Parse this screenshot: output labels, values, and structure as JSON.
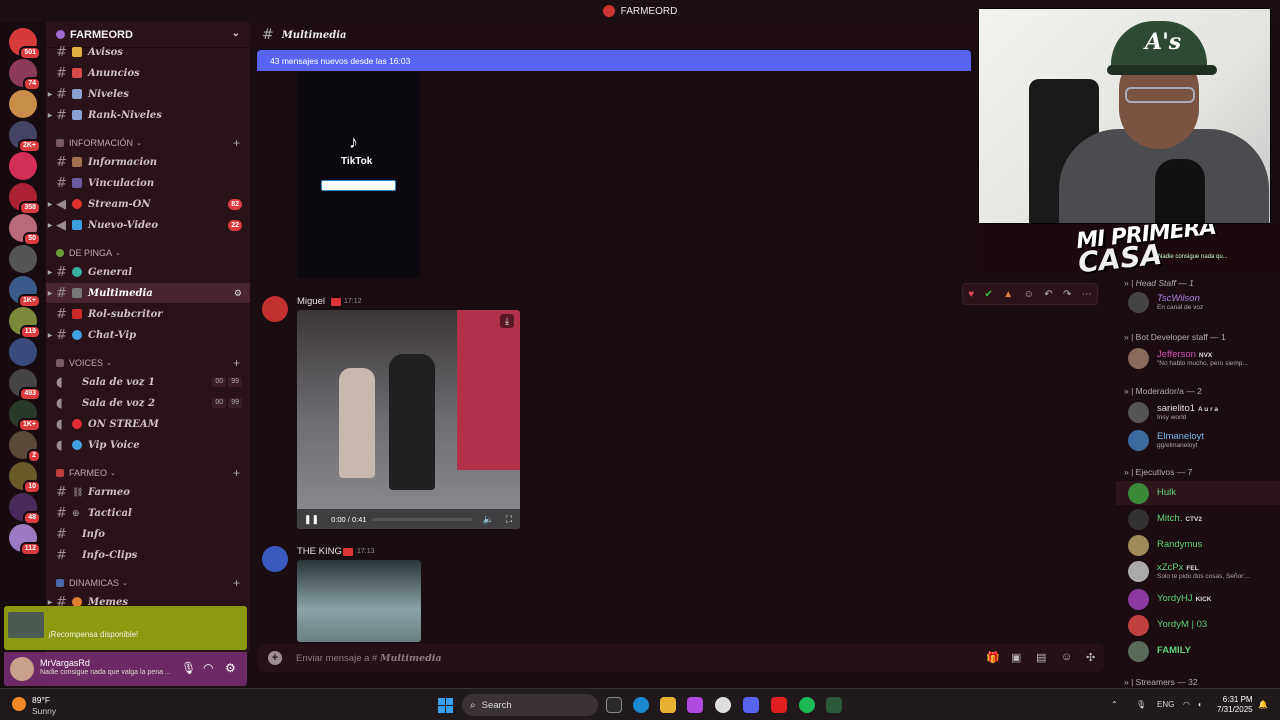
{
  "window": {
    "title": "FARMEORD"
  },
  "servers": [
    {
      "badge": "501",
      "color": "#d63a3a"
    },
    {
      "badge": "74",
      "color": "#8c3b5a"
    },
    {
      "badge": "",
      "color": "#c98f4a"
    },
    {
      "badge": "2K+",
      "color": "#446"
    },
    {
      "badge": "",
      "color": "#d22e58"
    },
    {
      "badge": "358",
      "color": "#a23"
    },
    {
      "badge": "50",
      "color": "#b86a7a"
    },
    {
      "badge": "",
      "color": "#555"
    },
    {
      "badge": "1K+",
      "color": "#3a5a8a"
    },
    {
      "badge": "119",
      "color": "#7a8a3a"
    },
    {
      "badge": "",
      "color": "#3a4a7a"
    },
    {
      "badge": "493",
      "color": "#444"
    },
    {
      "badge": "1K+",
      "color": "#2a3a2a"
    },
    {
      "badge": "2",
      "color": "#5a4a3a"
    },
    {
      "badge": "10",
      "color": "#6a5a2a"
    },
    {
      "badge": "48",
      "color": "#4a2a5a"
    },
    {
      "badge": "112",
      "color": "#9a7ac0"
    }
  ],
  "sidebar": {
    "server_name": "FARMEORD",
    "channels": [
      {
        "name": "Avisos",
        "emoji_color": "#e0b040",
        "type": "text"
      },
      {
        "name": "Anuncios",
        "emoji_color": "#d84a4a",
        "type": "text"
      },
      {
        "name": "Niveles",
        "emoji_color": "#8aa0d0",
        "type": "text"
      },
      {
        "name": "Rank-Niveles",
        "emoji_color": "#8aa0d0",
        "type": "text"
      }
    ],
    "categories": {
      "informacion": "INFORMACIÓN",
      "de_pinga": "DE PINGA",
      "voices": "VOICES",
      "farmeo": "FARMEO",
      "dinamicas": "DINAMICAS"
    },
    "info_channels": [
      {
        "name": "Informacion",
        "emoji_color": "#a07050"
      },
      {
        "name": "Vinculacion",
        "emoji_color": "#6a5aa0"
      },
      {
        "name": "Stream-ON",
        "emoji_color": "#e03030",
        "count": "82"
      },
      {
        "name": "Nuevo-Video",
        "emoji_color": "#3aa0e0",
        "count": "22"
      }
    ],
    "pinga_channels": [
      {
        "name": "General",
        "emoji_color": "#3ab0a0"
      },
      {
        "name": "Multimedia",
        "emoji_color": "#777"
      },
      {
        "name": "Rol-subcritor",
        "emoji_color": "#d02a2a"
      },
      {
        "name": "Chat-Vip",
        "emoji_color": "#40a0e0"
      }
    ],
    "voice_channels": [
      {
        "name": "Sala de voz 1",
        "a": "00",
        "b": "99"
      },
      {
        "name": "Sala de voz 2",
        "a": "00",
        "b": "99"
      },
      {
        "name": "ON STREAM",
        "emoji_color": "#e03030"
      },
      {
        "name": "Vip Voice",
        "emoji_color": "#40a0e0"
      }
    ],
    "farmeo_channels": [
      {
        "name": "Farmeo"
      },
      {
        "name": "Tactical"
      },
      {
        "name": "Info"
      },
      {
        "name": "Info-Clips"
      }
    ],
    "dinamicas_channels": [
      {
        "name": "Memes",
        "emoji_color": "#e08030"
      }
    ]
  },
  "reward": {
    "text": "¡Recompensa disponible!"
  },
  "user": {
    "name": "MrVargasRd",
    "status": "Nadie consigue nada que valga la pena ..."
  },
  "main": {
    "channel_title": "Multimedia",
    "new_messages": "43 mensajes nuevos desde las 16:03",
    "tiktok_label": "TikTok",
    "tiktok_logo": "♪",
    "messages": [
      {
        "author": "Miguel",
        "time": "17:12",
        "video_time": "0:00 / 0:41",
        "video_progress": 0
      },
      {
        "author": "THE KING",
        "time": "17:13"
      }
    ],
    "composer_placeholder": "Enviar mensaje a #",
    "composer_channel": "Multimedia"
  },
  "overlay": {
    "banner_line1": "MI PRIMERA",
    "banner_line2": "CASA",
    "banner_sub": "Nadie consigue nada qu..."
  },
  "members": {
    "categories": [
      {
        "label": "Head Staff — 1"
      },
      {
        "label": "Bot Developer staff — 1"
      },
      {
        "label": "Moderador/a — 2"
      },
      {
        "label": "Ejecutivos — 7"
      },
      {
        "label": "Streamers — 32"
      }
    ],
    "list": [
      {
        "name": "TscWilson",
        "status": "En canal de voz",
        "color": "#b07ce0",
        "av": "#444"
      },
      {
        "name": "Jefferson",
        "tag": "NVX",
        "status": "\"No hablo mucho, pero siemp...",
        "color": "#d050b0",
        "av": "#8a6a5a"
      },
      {
        "name": "sarielito1",
        "tag": "A u r a",
        "status": "Insy world",
        "color": "#ddd",
        "av": "#555"
      },
      {
        "name": "Elmaneloyt",
        "status": "gg/elmaneloyt",
        "color": "#7ab8e8",
        "av": "#3a6aa0"
      },
      {
        "name": "Hulk",
        "color": "#62d27a",
        "av": "#3a8a3a"
      },
      {
        "name": "Mitch.",
        "tag": "CTV2",
        "color": "#62d27a",
        "av": "#333"
      },
      {
        "name": "Randymus",
        "color": "#62d27a",
        "av": "#a08a5a"
      },
      {
        "name": "xZcPx",
        "tag": "FEL",
        "status": "Solo te pido dos cosas, Señor:...",
        "color": "#62d27a",
        "av": "#aaa"
      },
      {
        "name": "YordyHJ",
        "tag": "KICK",
        "color": "#62d27a",
        "av": "#8a3aa0"
      },
      {
        "name": "YordyM | 03",
        "color": "#62d27a",
        "av": "#c04040"
      },
      {
        "name": "FAMILY",
        "color": "#62d27a",
        "av": "#5a6a5a"
      }
    ]
  },
  "taskbar": {
    "temp": "89°F",
    "condition": "Sunny",
    "search": "Search",
    "lang": "ENG",
    "time": "6:31 PM",
    "date": "7/31/2025"
  }
}
